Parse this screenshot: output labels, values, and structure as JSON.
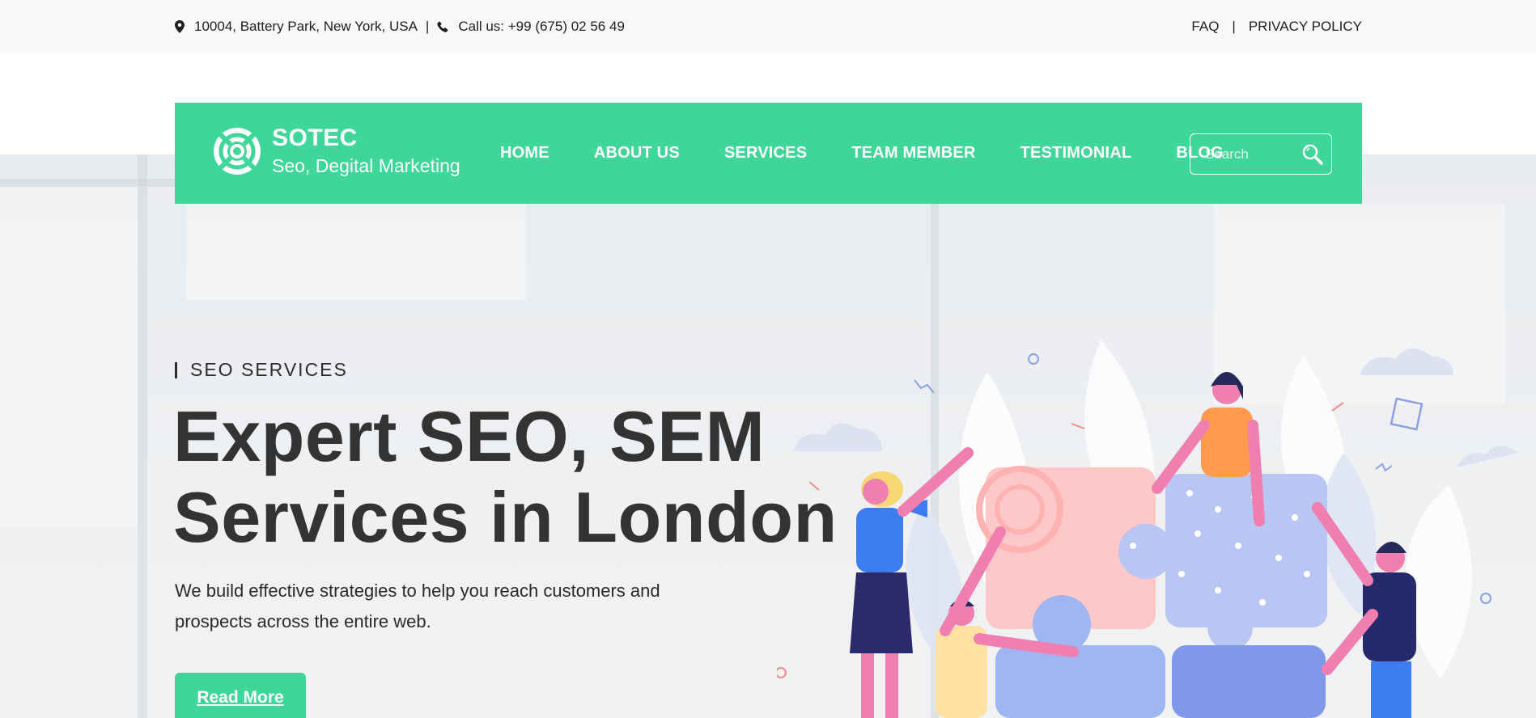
{
  "topbar": {
    "address": "10004, Battery Park, New York, USA",
    "separator": "|",
    "phone": "Call us: +99 (675) 02 56 49",
    "links": [
      "FAQ",
      "PRIVACY POLICY"
    ]
  },
  "brand": {
    "name": "SOTEC",
    "tagline": "Seo, Degital Marketing"
  },
  "nav": {
    "items": [
      "HOME",
      "ABOUT US",
      "SERVICES",
      "TEAM MEMBER",
      "TESTIMONIAL",
      "BLOG"
    ],
    "search_placeholder": "Search"
  },
  "hero": {
    "eyebrow": "SEO SERVICES",
    "title_line1": "Expert SEO, SEM",
    "title_line2": "Services in London",
    "description": "We build effective strategies to help you reach customers and prospects across the entire web.",
    "cta": "Read More"
  },
  "colors": {
    "accent": "#3fd69a",
    "topbar_bg": "#f8f8f8",
    "hero_bg": "#eceef1",
    "heading": "#333333"
  },
  "icons": [
    "map-pin-icon",
    "phone-icon",
    "lifebuoy-logo-icon",
    "search-icon"
  ]
}
